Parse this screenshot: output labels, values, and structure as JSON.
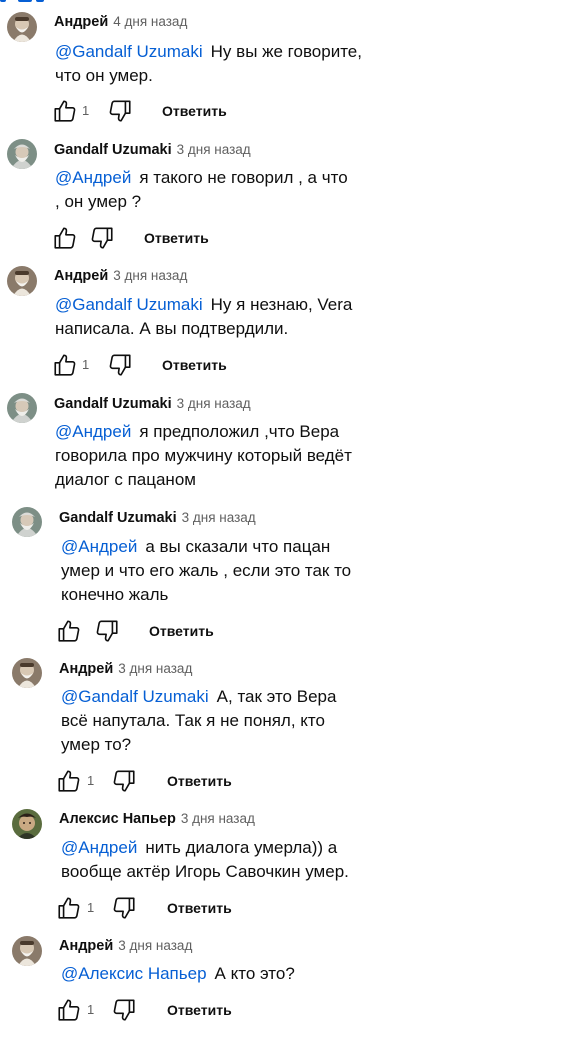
{
  "comments": [
    {
      "author": "Андрей",
      "time": "4 дня назад",
      "mention": "@Gandalf Uzumaki",
      "text": "Ну вы же говорите, что он умер.",
      "likes": "1",
      "reply_label": "Ответить",
      "avatar_icon": "avatar-old-man-icon"
    },
    {
      "author": "Gandalf Uzumaki",
      "time": "3 дня назад",
      "mention": "@Андрей",
      "text": "я такого не говорил , а что , он умер ?",
      "likes": "",
      "reply_label": "Ответить",
      "avatar_icon": "avatar-gandalf-icon"
    },
    {
      "author": "Андрей",
      "time": "3 дня назад",
      "mention": "@Gandalf Uzumaki",
      "text": "Ну я незнаю, Vera написала. А вы подтвердили.",
      "likes": "1",
      "reply_label": "Ответить",
      "avatar_icon": "avatar-old-man-icon"
    },
    {
      "author": "Gandalf Uzumaki",
      "time": "3 дня назад",
      "mention": "@Андрей",
      "text": "я предположил ,что Вера говорила про мужчину который ведёт диалог с пацаном",
      "likes": "",
      "reply_label": "",
      "avatar_icon": "avatar-gandalf-icon"
    },
    {
      "author": "Gandalf Uzumaki",
      "time": "3 дня назад",
      "mention": "@Андрей",
      "text": "а вы сказали что пацан умер и что его жаль , если это так то конечно жаль",
      "likes": "",
      "reply_label": "Ответить",
      "avatar_icon": "avatar-gandalf-icon"
    },
    {
      "author": "Андрей",
      "time": "3 дня назад",
      "mention": "@Gandalf Uzumaki",
      "text": "А, так это Вера всё напутала. Так я не понял, кто умер то?",
      "likes": "1",
      "reply_label": "Ответить",
      "avatar_icon": "avatar-old-man-icon"
    },
    {
      "author": "Алексис Напьер",
      "time": "3 дня назад",
      "mention": "@Андрей",
      "text": "нить диалога умерла)) а вообще актёр Игорь Савочкин умер.",
      "likes": "1",
      "reply_label": "Ответить",
      "avatar_icon": "avatar-alexis-icon"
    },
    {
      "author": "Андрей",
      "time": "3 дня назад",
      "mention": "@Алексис Напьер",
      "text": "А кто это?",
      "likes": "1",
      "reply_label": "Ответить",
      "avatar_icon": "avatar-old-man-icon"
    }
  ],
  "colors": {
    "mention": "#065fd4",
    "secondary_text": "#606060",
    "primary_text": "#0f0f0f"
  }
}
